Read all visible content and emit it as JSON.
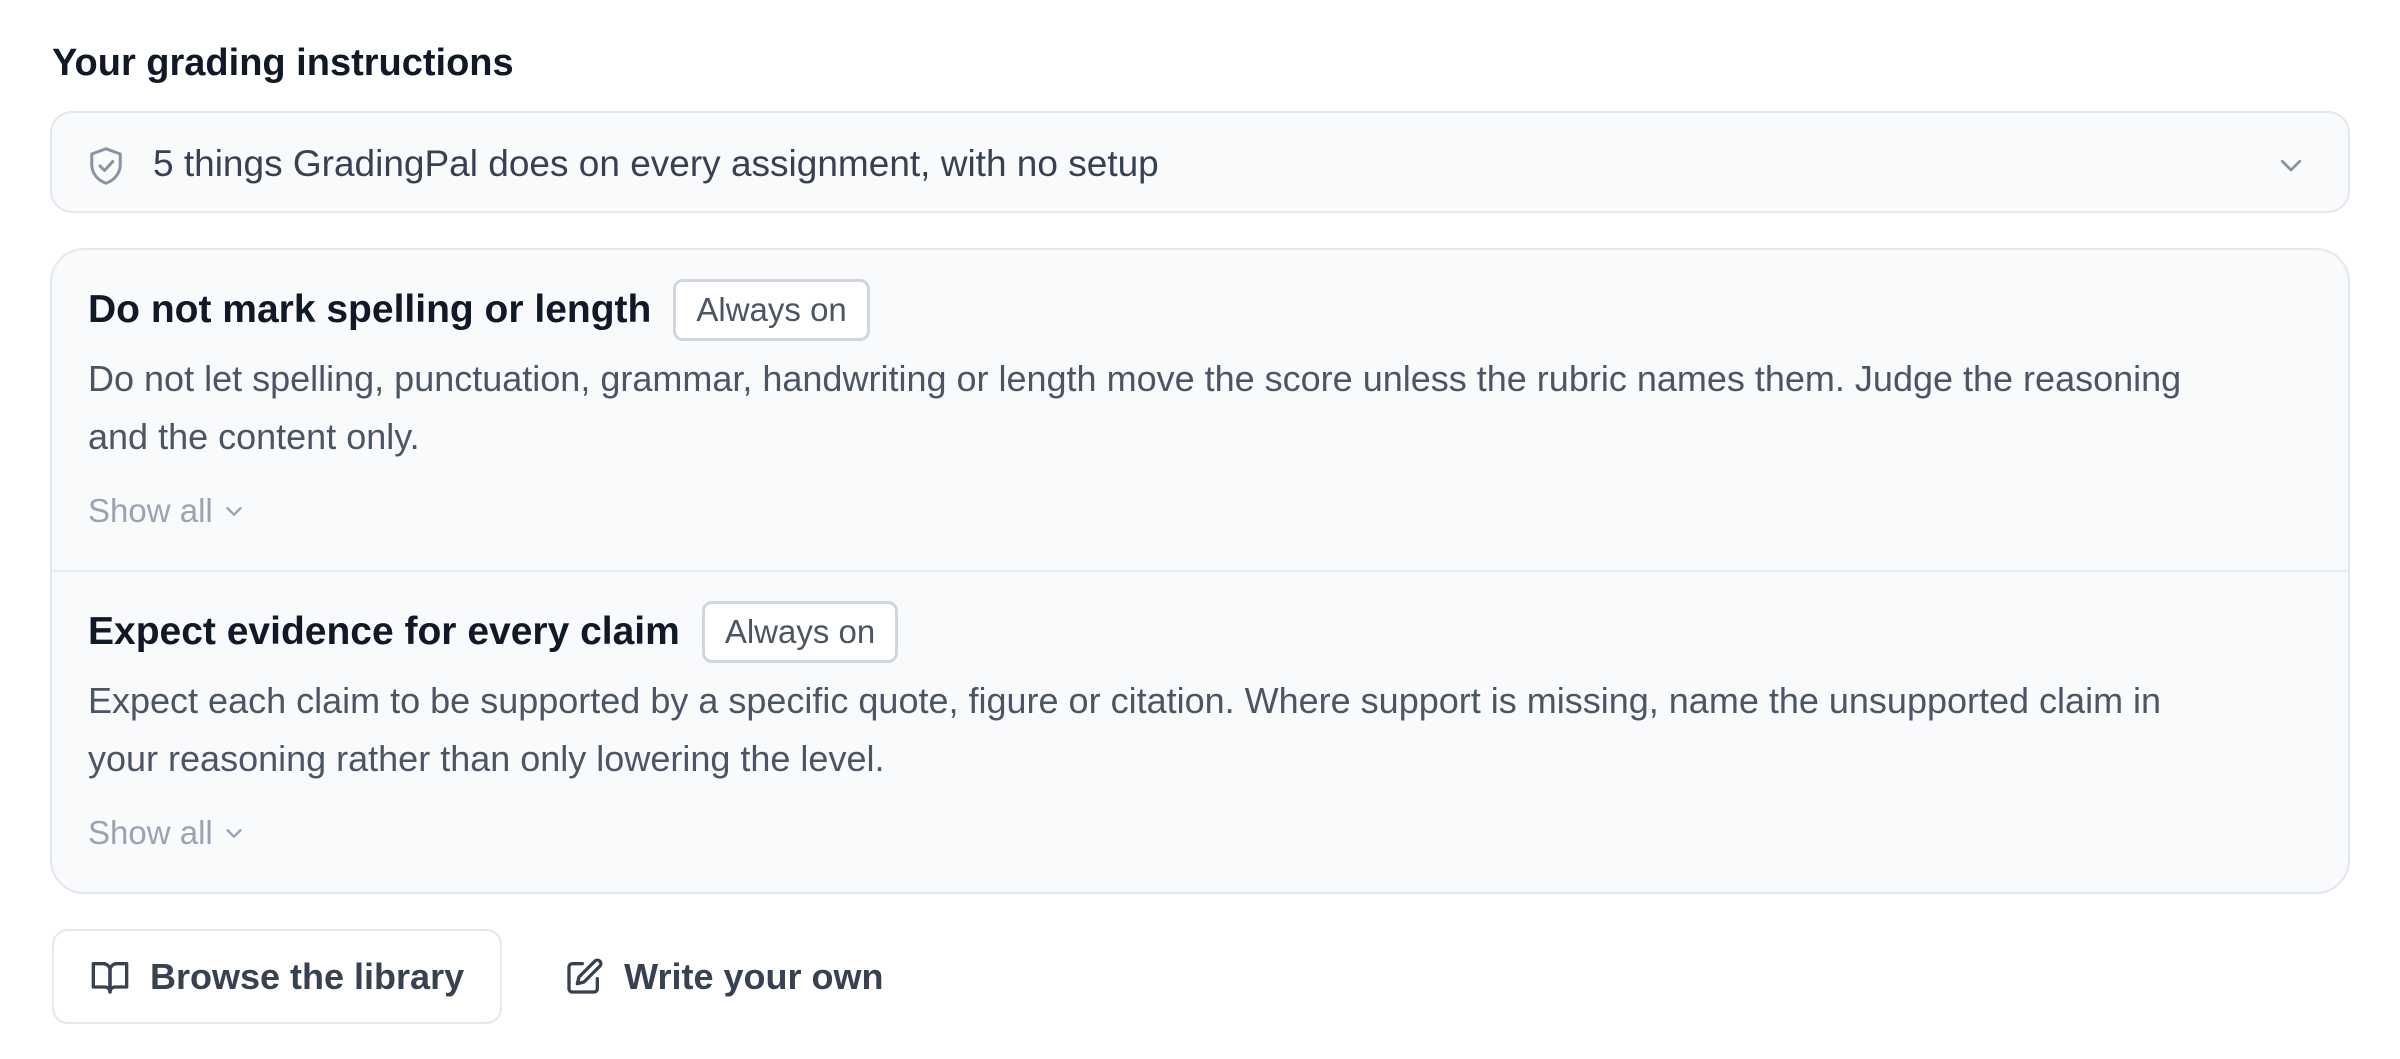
{
  "section": {
    "title": "Your grading instructions"
  },
  "summary": {
    "icon": "shield-check-icon",
    "text": "5 things GradingPal does on every assignment, with no setup",
    "toggle_icon": "chevron-down-icon"
  },
  "instructions": [
    {
      "title": "Do not mark spelling or length",
      "badge": "Always on",
      "description": "Do not let spelling, punctuation, grammar, handwriting or length move the score unless the rubric names them. Judge the reasoning and the content only.",
      "show_all": "Show all"
    },
    {
      "title": "Expect evidence for every claim",
      "badge": "Always on",
      "description": "Expect each claim to be supported by a specific quote, figure or citation. Where support is missing, name the unsupported claim in your reasoning rather than only lowering the level.",
      "show_all": "Show all"
    }
  ],
  "actions": {
    "browse_label": "Browse the library",
    "browse_icon": "book-open-icon",
    "write_label": "Write your own",
    "write_icon": "pencil-square-icon"
  },
  "colors": {
    "text_primary": "#111827",
    "text_body": "#4b5563",
    "text_muted": "#9aa3b2",
    "card_bg": "#f8fafc",
    "border": "#e3e7ee"
  }
}
